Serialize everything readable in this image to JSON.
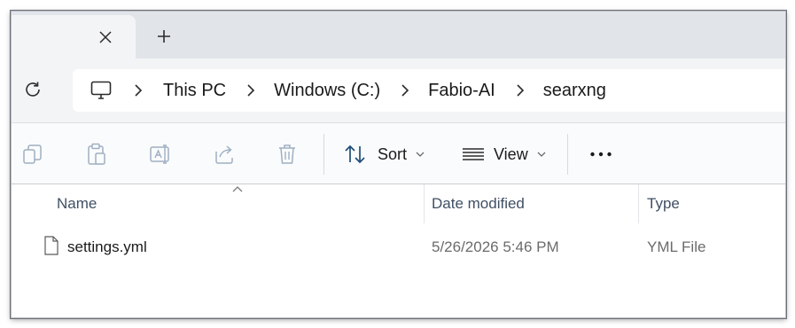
{
  "tabs": {
    "close_icon": "close-icon",
    "new_tab_icon": "plus-icon"
  },
  "address": {
    "refresh_icon": "refresh-icon",
    "root_icon": "monitor-icon",
    "crumbs": [
      "This PC",
      "Windows (C:)",
      "Fabio-AI",
      "searxng"
    ]
  },
  "toolbar": {
    "icons": [
      "copy-icon",
      "paste-icon",
      "rename-icon",
      "share-icon",
      "delete-icon"
    ],
    "sort_label": "Sort",
    "view_label": "View",
    "more_icon": "ellipsis-icon"
  },
  "columns": {
    "name": "Name",
    "date": "Date modified",
    "type": "Type"
  },
  "files": [
    {
      "name": "settings.yml",
      "date": "5/26/2026 5:46 PM",
      "type": "YML File"
    }
  ],
  "colors": {
    "tabstrip": "#e1e5ea",
    "address_bg": "#f3f4f6",
    "header_text": "#3f4f64",
    "muted_text": "#6b6b6b",
    "disabled_icon": "#9fb0c2"
  }
}
